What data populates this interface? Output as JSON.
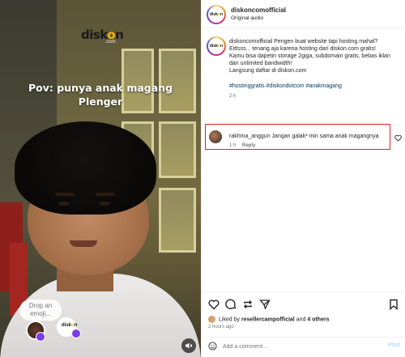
{
  "video": {
    "logo_text_a": "disk",
    "logo_text_o": "o",
    "logo_text_b": "n",
    "logo_sub": ".com",
    "overlay_line1": "Pov: punya anak magang",
    "overlay_line2": "Plenger",
    "drop_emoji_line1": "Drop an",
    "drop_emoji_line2": "emoji...",
    "mute_icon": "speaker-muted-icon"
  },
  "post_header": {
    "username": "diskoncomofficial",
    "audio": "Original audio"
  },
  "caption": {
    "username": "diskoncomofficial",
    "line1": "Pengen buat website tapi hosting mahal?",
    "line2": "Eittsss... tenang aja karena hosting dari diskon.com gratis!",
    "line3": "Kamu bisa dapetin storage 2giga, subdomain gratis, bebas iklan",
    "line4": "dan unlimited bandwidth!",
    "line5": "Langsung daftar di diskon.com",
    "hashtags": "#hostinggratis #diskondotcom #anakmagang",
    "time": "2 h"
  },
  "comment": {
    "username": "rakhma_anggun",
    "text": "Jangan galak² min sama anak magangnya",
    "time": "1 h",
    "reply_label": "Reply"
  },
  "actions": {
    "like_icon": "heart-icon",
    "comment_icon": "comment-icon",
    "repost_icon": "repost-icon",
    "share_icon": "share-icon",
    "save_icon": "bookmark-icon"
  },
  "likes": {
    "prefix": "Liked by",
    "user": "resellercampofficial",
    "connector": "and",
    "others": "4 others"
  },
  "post_time": "2 hours ago",
  "comment_input": {
    "placeholder": "Add a comment...",
    "post_label": "Post"
  },
  "colors": {
    "highlight_border": "#e0202c",
    "link": "#00376b",
    "post_disabled": "#b2dffc"
  }
}
